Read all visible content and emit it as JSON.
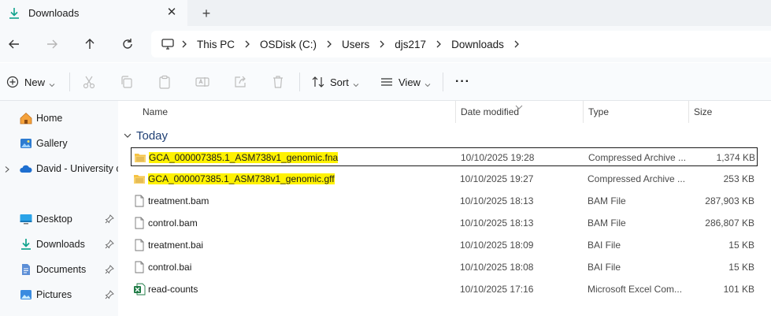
{
  "tab": {
    "title": "Downloads",
    "close": "✕",
    "new_tab": "+"
  },
  "breadcrumb": [
    "This PC",
    "OSDisk (C:)",
    "Users",
    "djs217",
    "Downloads"
  ],
  "toolbar": {
    "new_label": "New",
    "sort_label": "Sort",
    "view_label": "View",
    "more_label": "···"
  },
  "sidebar": {
    "items": [
      {
        "label": "Home",
        "icon": "home-icon"
      },
      {
        "label": "Gallery",
        "icon": "gallery-icon"
      },
      {
        "label": "David - University c",
        "icon": "onedrive-icon"
      },
      {
        "label": "Desktop",
        "icon": "desktop-icon"
      },
      {
        "label": "Downloads",
        "icon": "download-icon"
      },
      {
        "label": "Documents",
        "icon": "documents-icon"
      },
      {
        "label": "Pictures",
        "icon": "pictures-icon"
      }
    ]
  },
  "columns": {
    "name": "Name",
    "date": "Date modified",
    "type": "Type",
    "size": "Size"
  },
  "group": {
    "label": "Today"
  },
  "files": [
    {
      "name": "GCA_000007385.1_ASM738v1_genomic.fna",
      "date": "10/10/2025 19:28",
      "type": "Compressed Archive ...",
      "size": "1,374 KB",
      "icon": "zip-folder-icon"
    },
    {
      "name": "GCA_000007385.1_ASM738v1_genomic.gff",
      "date": "10/10/2025 19:27",
      "type": "Compressed Archive ...",
      "size": "253 KB",
      "icon": "zip-folder-icon"
    },
    {
      "name": "treatment.bam",
      "date": "10/10/2025 18:13",
      "type": "BAM File",
      "size": "287,903 KB",
      "icon": "file-icon"
    },
    {
      "name": "control.bam",
      "date": "10/10/2025 18:13",
      "type": "BAM File",
      "size": "286,807 KB",
      "icon": "file-icon"
    },
    {
      "name": "treatment.bai",
      "date": "10/10/2025 18:09",
      "type": "BAI File",
      "size": "15 KB",
      "icon": "file-icon"
    },
    {
      "name": "control.bai",
      "date": "10/10/2025 18:08",
      "type": "BAI File",
      "size": "15 KB",
      "icon": "file-icon"
    },
    {
      "name": "read-counts",
      "date": "10/10/2025 17:16",
      "type": "Microsoft Excel Com...",
      "size": "101 KB",
      "icon": "excel-icon"
    }
  ],
  "highlight_color": "#fff200",
  "accent_color": "#0f9d8a"
}
